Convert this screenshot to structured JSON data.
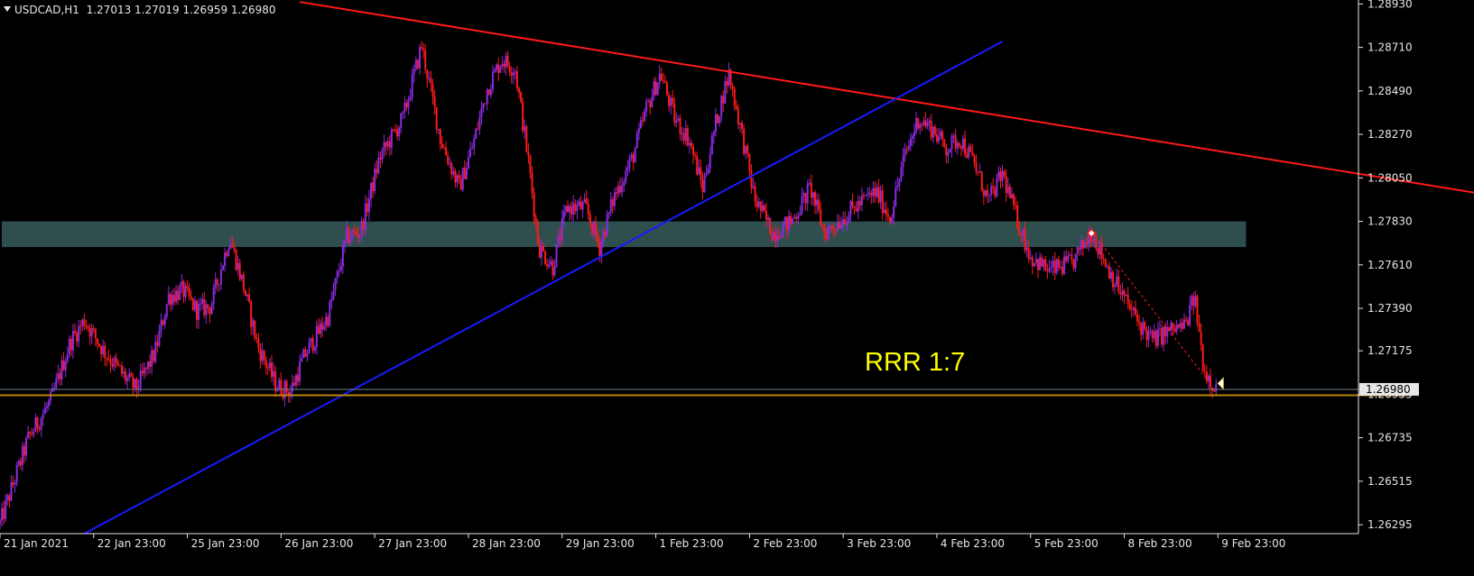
{
  "header": {
    "symbol": "USDCAD,H1",
    "ohlc": "1.27013 1.27019 1.26959 1.26980"
  },
  "annotation": "RRR 1:7",
  "colors": {
    "background": "#000000",
    "axis": "#e6e6e6",
    "bull": "#8a2be2",
    "bear": "#ff1a1a",
    "zone": "#2f4f4f",
    "resistance": "#ff1a1a",
    "support": "#1a1aff",
    "level": "#b8860b",
    "annotation": "#ffff00",
    "price_box": "#e6e6e6"
  },
  "chart_data": {
    "type": "candlestick",
    "symbol": "USDCAD",
    "timeframe": "H1",
    "ylim": [
      1.2625,
      1.2895
    ],
    "y_ticks": [
      "1.28930",
      "1.28710",
      "1.28490",
      "1.28270",
      "1.28050",
      "1.27830",
      "1.27610",
      "1.27390",
      "1.27175",
      "1.26955",
      "1.26735",
      "1.26515",
      "1.26295"
    ],
    "x_ticks": [
      "21 Jan 2021",
      "22 Jan 23:00",
      "25 Jan 23:00",
      "26 Jan 23:00",
      "27 Jan 23:00",
      "28 Jan 23:00",
      "29 Jan 23:00",
      "1 Feb 23:00",
      "2 Feb 23:00",
      "3 Feb 23:00",
      "4 Feb 23:00",
      "5 Feb 23:00",
      "8 Feb 23:00",
      "9 Feb 23:00"
    ],
    "x_range": [
      0,
      14.5
    ],
    "current_price": "1.26980",
    "zone": {
      "from": 0,
      "to": 13.3,
      "low": 1.277,
      "high": 1.2783
    },
    "resistance_line": {
      "x": [
        3.2,
        16.2
      ],
      "y": [
        1.2894,
        1.2794
      ]
    },
    "support_line": {
      "x": [
        0.9,
        10.7
      ],
      "y": [
        1.2625,
        1.2874
      ]
    },
    "horizontal_level": {
      "x": [
        0,
        15.0
      ],
      "y": 1.2695
    },
    "dashed_trade_line": {
      "x": [
        11.65,
        12.9
      ],
      "y": [
        1.2778,
        1.2702
      ]
    },
    "entry_marker": {
      "x": 11.65,
      "y": 1.2777
    },
    "close_marker": {
      "x": 12.99,
      "y": 1.2701
    },
    "anchors": [
      [
        0.0,
        1.263
      ],
      [
        0.3,
        1.2673
      ],
      [
        0.55,
        1.2693
      ],
      [
        0.75,
        1.2722
      ],
      [
        0.9,
        1.2733
      ],
      [
        1.1,
        1.2718
      ],
      [
        1.3,
        1.2706
      ],
      [
        1.45,
        1.2698
      ],
      [
        1.65,
        1.2716
      ],
      [
        1.8,
        1.2745
      ],
      [
        1.95,
        1.2748
      ],
      [
        2.1,
        1.2738
      ],
      [
        2.25,
        1.274
      ],
      [
        2.45,
        1.2775
      ],
      [
        2.6,
        1.275
      ],
      [
        2.75,
        1.272
      ],
      [
        2.95,
        1.27
      ],
      [
        3.1,
        1.2697
      ],
      [
        3.25,
        1.2715
      ],
      [
        3.5,
        1.2735
      ],
      [
        3.7,
        1.2775
      ],
      [
        3.85,
        1.2778
      ],
      [
        4.05,
        1.2815
      ],
      [
        4.3,
        1.2835
      ],
      [
        4.5,
        1.2872
      ],
      [
        4.7,
        1.2825
      ],
      [
        4.9,
        1.28
      ],
      [
        5.05,
        1.2822
      ],
      [
        5.2,
        1.285
      ],
      [
        5.35,
        1.2865
      ],
      [
        5.5,
        1.286
      ],
      [
        5.65,
        1.281
      ],
      [
        5.75,
        1.277
      ],
      [
        5.9,
        1.276
      ],
      [
        6.05,
        1.279
      ],
      [
        6.25,
        1.279
      ],
      [
        6.4,
        1.277
      ],
      [
        6.55,
        1.2795
      ],
      [
        6.75,
        1.2815
      ],
      [
        6.9,
        1.284
      ],
      [
        7.05,
        1.2858
      ],
      [
        7.2,
        1.2835
      ],
      [
        7.35,
        1.2825
      ],
      [
        7.5,
        1.28
      ],
      [
        7.65,
        1.2835
      ],
      [
        7.78,
        1.2858
      ],
      [
        7.95,
        1.282
      ],
      [
        8.05,
        1.2795
      ],
      [
        8.25,
        1.2777
      ],
      [
        8.45,
        1.2783
      ],
      [
        8.65,
        1.28
      ],
      [
        8.8,
        1.2777
      ],
      [
        8.95,
        1.2783
      ],
      [
        9.2,
        1.2793
      ],
      [
        9.35,
        1.2798
      ],
      [
        9.5,
        1.2785
      ],
      [
        9.65,
        1.2815
      ],
      [
        9.8,
        1.2835
      ],
      [
        9.95,
        1.283
      ],
      [
        10.1,
        1.282
      ],
      [
        10.25,
        1.2825
      ],
      [
        10.4,
        1.2812
      ],
      [
        10.55,
        1.2793
      ],
      [
        10.7,
        1.2807
      ],
      [
        10.85,
        1.2785
      ],
      [
        11.0,
        1.2765
      ],
      [
        11.2,
        1.2758
      ],
      [
        11.45,
        1.2762
      ],
      [
        11.65,
        1.2778
      ],
      [
        11.8,
        1.2762
      ],
      [
        11.95,
        1.2748
      ],
      [
        12.15,
        1.2732
      ],
      [
        12.3,
        1.2723
      ],
      [
        12.5,
        1.2728
      ],
      [
        12.65,
        1.273
      ],
      [
        12.75,
        1.2745
      ],
      [
        12.85,
        1.2708
      ],
      [
        12.99,
        1.2698
      ]
    ]
  }
}
